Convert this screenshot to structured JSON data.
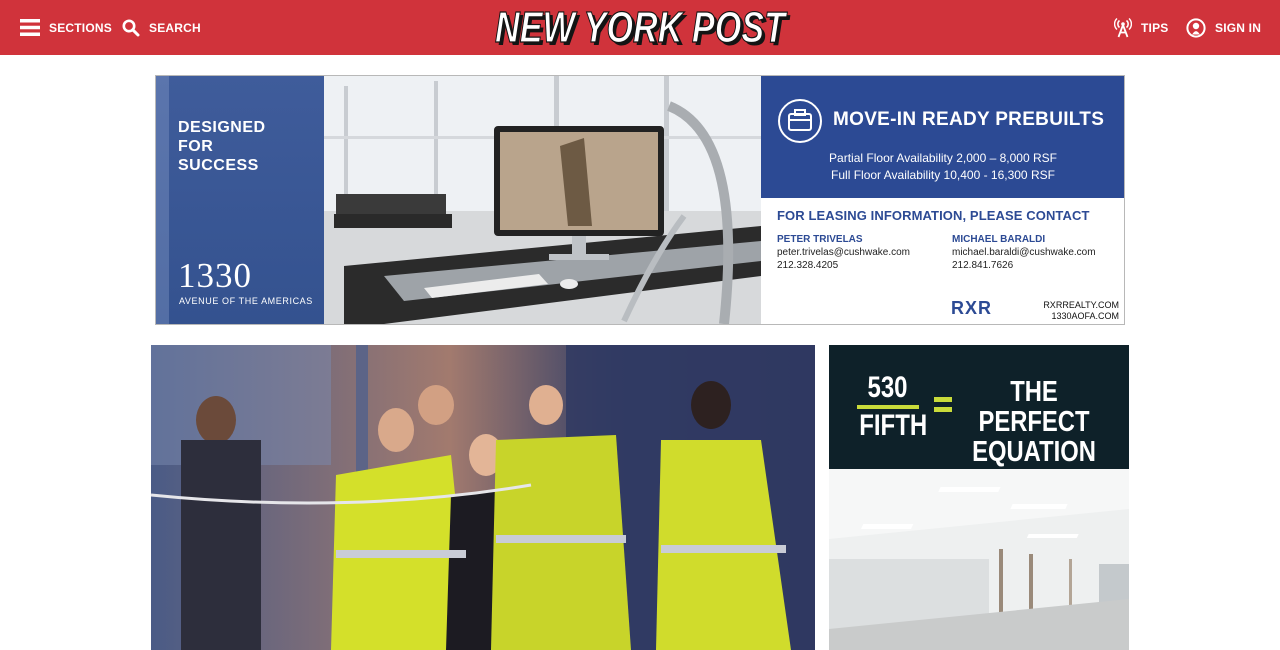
{
  "header": {
    "sections_label": "SECTIONS",
    "search_label": "SEARCH",
    "logo_text": "NEW YORK POST",
    "tips_label": "TIPS",
    "signin_label": "SIGN IN",
    "colors": {
      "bar": "#d0333b",
      "text": "#ffffff"
    },
    "icons": [
      "hamburger-icon",
      "search-icon",
      "broadcast-tower-icon",
      "user-circle-icon"
    ]
  },
  "banner_ad": {
    "tagline": "DESIGNED FOR SUCCESS",
    "address_number": "1330",
    "address_street": "AVENUE OF THE AMERICAS",
    "headline": "MOVE-IN READY PREBUILTS",
    "partial_floor": "Partial Floor Availability 2,000 – 8,000 RSF",
    "full_floor": "Full Floor Availability 10,400 - 16,300 RSF",
    "contact_heading": "FOR LEASING INFORMATION, PLEASE CONTACT",
    "contacts": [
      {
        "name": "PETER TRIVELAS",
        "email": "peter.trivelas@cushwake.com",
        "phone": "212.328.4205"
      },
      {
        "name": "MICHAEL BARALDI",
        "email": "michael.baraldi@cushwake.com",
        "phone": "212.841.7626"
      }
    ],
    "brand_logo": "RXR",
    "site_1": "RXRREALTY.COM",
    "site_2": "1330AOFA.COM",
    "colors": {
      "blue": "#2c4a94",
      "left_panel": "#3f5c9b"
    },
    "icon": "briefcase-icon"
  },
  "side_ad": {
    "number": "530",
    "street": "FIFTH",
    "tagline_line1": "THE PERFECT",
    "tagline_line2": "EQUATION",
    "colors": {
      "background": "#0e2129",
      "accent": "#c9db3a"
    }
  }
}
